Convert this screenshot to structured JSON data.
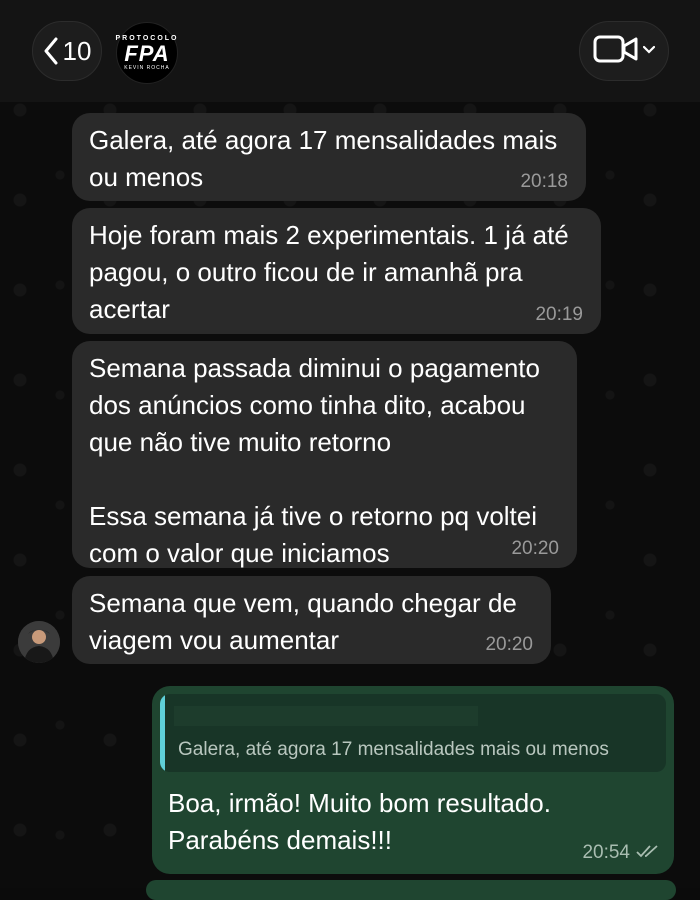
{
  "header": {
    "back_count": "10",
    "logo_top": "PROTOCOLO",
    "logo_main": "FPA",
    "logo_sub": "KEVIN ROCHA"
  },
  "messages": [
    {
      "text": "Galera, até agora 17 mensalidades mais\nou menos",
      "time": "20:18"
    },
    {
      "text": "Hoje foram mais 2 experimentais. 1 já até\npagou, o outro ficou de ir amanhã pra\nacertar",
      "time": "20:19"
    },
    {
      "text": "Semana passada diminui o pagamento\ndos anúncios como tinha dito, acabou\nque não tive muito retorno\n\nEssa semana já tive o retorno pq voltei\ncom o valor que iniciamos",
      "time": "20:20"
    },
    {
      "text": "Semana que vem, quando chegar de\nviagem vou aumentar",
      "time": "20:20"
    }
  ],
  "reply": {
    "quoted_text": "Galera, até agora 17 mensalidades mais ou menos",
    "text": "Boa, irmão! Muito bom resultado.\nParabéns demais!!!",
    "time": "20:54",
    "status_icon": "double-check-icon"
  },
  "colors": {
    "incoming_bubble": "#2a2a2a",
    "outgoing_bubble": "#1f4530",
    "quote_accent": "#5fd0d8"
  }
}
